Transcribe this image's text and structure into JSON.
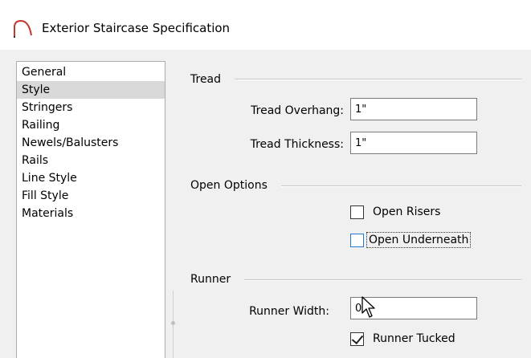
{
  "window": {
    "title": "Exterior Staircase Specification",
    "icon": "staircase-arch-icon"
  },
  "sidebar": {
    "items": [
      {
        "label": "General",
        "selected": false
      },
      {
        "label": "Style",
        "selected": true
      },
      {
        "label": "Stringers",
        "selected": false
      },
      {
        "label": "Railing",
        "selected": false
      },
      {
        "label": "Newels/Balusters",
        "selected": false
      },
      {
        "label": "Rails",
        "selected": false
      },
      {
        "label": "Line Style",
        "selected": false
      },
      {
        "label": "Fill Style",
        "selected": false
      },
      {
        "label": "Materials",
        "selected": false
      }
    ]
  },
  "tread": {
    "group_label": "Tread",
    "overhang_label": "Tread Overhang:",
    "overhang_value": "1\"",
    "thickness_label": "Tread Thickness:",
    "thickness_value": "1\""
  },
  "open_options": {
    "group_label": "Open Options",
    "open_risers_label": "Open Risers",
    "open_risers_checked": false,
    "open_underneath_label": "Open Underneath",
    "open_underneath_checked": false
  },
  "runner": {
    "group_label": "Runner",
    "width_label": "Runner Width:",
    "width_value": "0\"",
    "tucked_label": "Runner Tucked",
    "tucked_checked": true
  },
  "colors": {
    "dialog_bg": "#f0f0f0",
    "selection_bg": "#d9d9d9",
    "checkbox_hover": "#1e7ad6",
    "icon_red": "#c0392b"
  },
  "cursor": "pointer-arrow-icon"
}
